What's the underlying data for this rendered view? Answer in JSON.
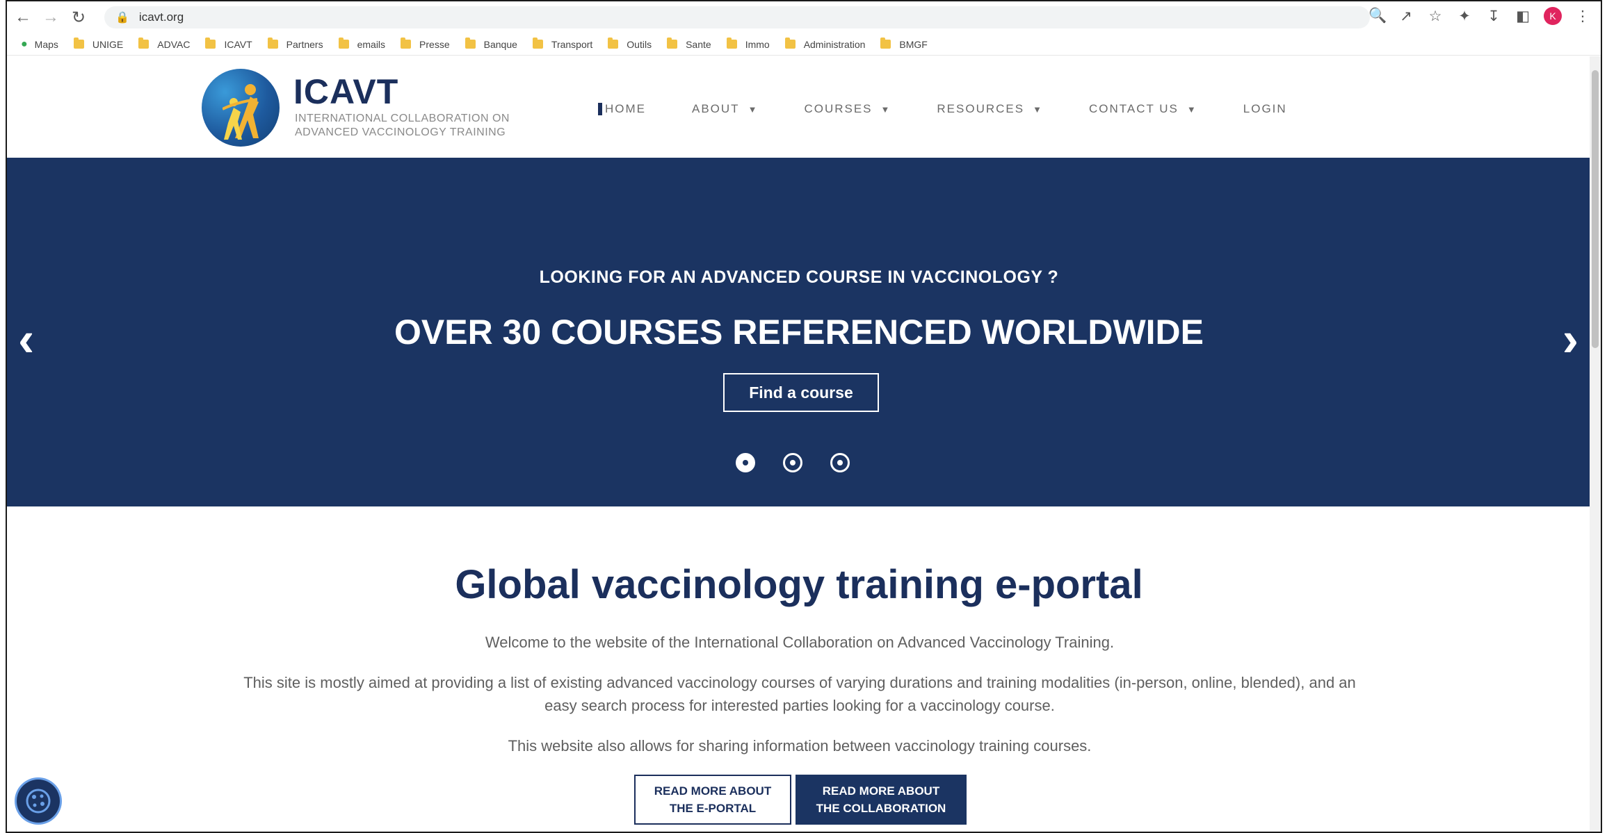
{
  "browser": {
    "url": "icavt.org",
    "bookmarks": [
      {
        "label": "Maps",
        "icon": "map-pin-icon"
      },
      {
        "label": "UNIGE",
        "icon": "folder-icon"
      },
      {
        "label": "ADVAC",
        "icon": "folder-icon"
      },
      {
        "label": "ICAVT",
        "icon": "folder-icon"
      },
      {
        "label": "Partners",
        "icon": "folder-icon"
      },
      {
        "label": "emails",
        "icon": "folder-icon"
      },
      {
        "label": "Presse",
        "icon": "folder-icon"
      },
      {
        "label": "Banque",
        "icon": "folder-icon"
      },
      {
        "label": "Transport",
        "icon": "folder-icon"
      },
      {
        "label": "Outils",
        "icon": "folder-icon"
      },
      {
        "label": "Sante",
        "icon": "folder-icon"
      },
      {
        "label": "Immo",
        "icon": "folder-icon"
      },
      {
        "label": "Administration",
        "icon": "folder-icon"
      },
      {
        "label": "BMGF",
        "icon": "folder-icon"
      }
    ],
    "profile_initial": "K"
  },
  "header": {
    "logo_title": "ICAVT",
    "logo_sub_line1": "INTERNATIONAL COLLABORATION ON",
    "logo_sub_line2": "ADVANCED VACCINOLOGY TRAINING",
    "menu": [
      {
        "label": "HOME",
        "dropdown": false
      },
      {
        "label": "ABOUT",
        "dropdown": true
      },
      {
        "label": "COURSES",
        "dropdown": true
      },
      {
        "label": "RESOURCES",
        "dropdown": true
      },
      {
        "label": "CONTACT US",
        "dropdown": true
      },
      {
        "label": "LOGIN",
        "dropdown": false
      }
    ]
  },
  "hero": {
    "kicker": "LOOKING FOR AN ADVANCED COURSE IN VACCINOLOGY ?",
    "title": "OVER 30 COURSES REFERENCED WORLDWIDE",
    "button": "Find a course",
    "slides": 3,
    "active_slide": 1
  },
  "main": {
    "title": "Global vaccinology training e-portal",
    "welcome": "Welcome to the website of the International Collaboration on Advanced Vaccinology Training.",
    "aim_line1": "This site is mostly aimed at providing a list of existing advanced vaccinology courses of varying durations and training modalities (in-person, online, blended), and an",
    "aim_line2": "easy search process for interested parties looking for a vaccinology course.",
    "sharing": "This website also allows for sharing information between vaccinology training courses.",
    "btn_eportal_line1": "READ MORE ABOUT",
    "btn_eportal_line2": "THE E-PORTAL",
    "btn_collab_line1": "READ MORE ABOUT",
    "btn_collab_line2": "THE COLLABORATION"
  },
  "colors": {
    "brand_navy": "#1b3462",
    "title_navy": "#1b2f5c",
    "folder_yellow": "#f2c244"
  }
}
